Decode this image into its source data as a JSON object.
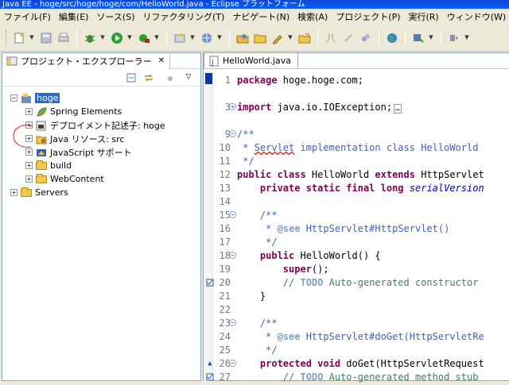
{
  "window": {
    "title": "Java EE - hoge/src/hoge/hoge/com/HelloWorld.java - Eclipse プラットフォーム"
  },
  "menubar": {
    "items": [
      "ファイル(F)",
      "編集(E)",
      "ソース(S)",
      "リファクタリング(T)",
      "ナビゲート(N)",
      "検索(A)",
      "プロジェクト(P)",
      "実行(R)",
      "ウィンドウ(W)",
      "ヘ"
    ]
  },
  "explorer": {
    "tab_label": "プロジェクト・エクスプローラー",
    "close_glyph": "✕",
    "tree": [
      {
        "label": "hoge",
        "expander": "−",
        "icon": "project-icon",
        "selected": true
      },
      {
        "label": "Spring Elements",
        "expander": "+",
        "icon": "spring-icon"
      },
      {
        "label": "デプロイメント記述子: hoge",
        "expander": "+",
        "icon": "deployment-descriptor-icon"
      },
      {
        "label": "Java リソース: src",
        "expander": "+",
        "icon": "java-resources-icon"
      },
      {
        "label": "JavaScript サポート",
        "expander": "+",
        "icon": "javascript-icon"
      },
      {
        "label": "build",
        "expander": "+",
        "icon": "folder-icon"
      },
      {
        "label": "WebContent",
        "expander": "+",
        "icon": "folder-icon"
      },
      {
        "label": "Servers",
        "expander": "+",
        "icon": "folder-icon"
      }
    ]
  },
  "editor": {
    "tab_label": "HelloWorld.java",
    "lines": [
      {
        "num": "1",
        "text": "package hoge.hoge.com;"
      },
      {
        "num": "3",
        "text": "import java.io.IOException;"
      },
      {
        "num": "9",
        "text": "/**"
      },
      {
        "num": "10",
        "text": " * Servlet implementation class HelloWorld"
      },
      {
        "num": "11",
        "text": " */"
      },
      {
        "num": "12",
        "text": "public class HelloWorld extends HttpServlet"
      },
      {
        "num": "13",
        "text": "    private static final long serialVersion"
      },
      {
        "num": "14",
        "text": ""
      },
      {
        "num": "15",
        "text": "    /**"
      },
      {
        "num": "16",
        "text": "     * @see HttpServlet#HttpServlet()"
      },
      {
        "num": "17",
        "text": "     */"
      },
      {
        "num": "18",
        "text": "    public HelloWorld() {"
      },
      {
        "num": "19",
        "text": "        super();"
      },
      {
        "num": "20",
        "text": "        // TODO Auto-generated constructor"
      },
      {
        "num": "21",
        "text": "    }"
      },
      {
        "num": "22",
        "text": ""
      },
      {
        "num": "23",
        "text": "    /**"
      },
      {
        "num": "24",
        "text": "     * @see HttpServlet#doGet(HttpServletRe"
      },
      {
        "num": "25",
        "text": "     */"
      },
      {
        "num": "26",
        "text": "    protected void doGet(HttpServletRequest"
      },
      {
        "num": "27",
        "text": "        // TODO Auto-generated method stub"
      }
    ]
  }
}
